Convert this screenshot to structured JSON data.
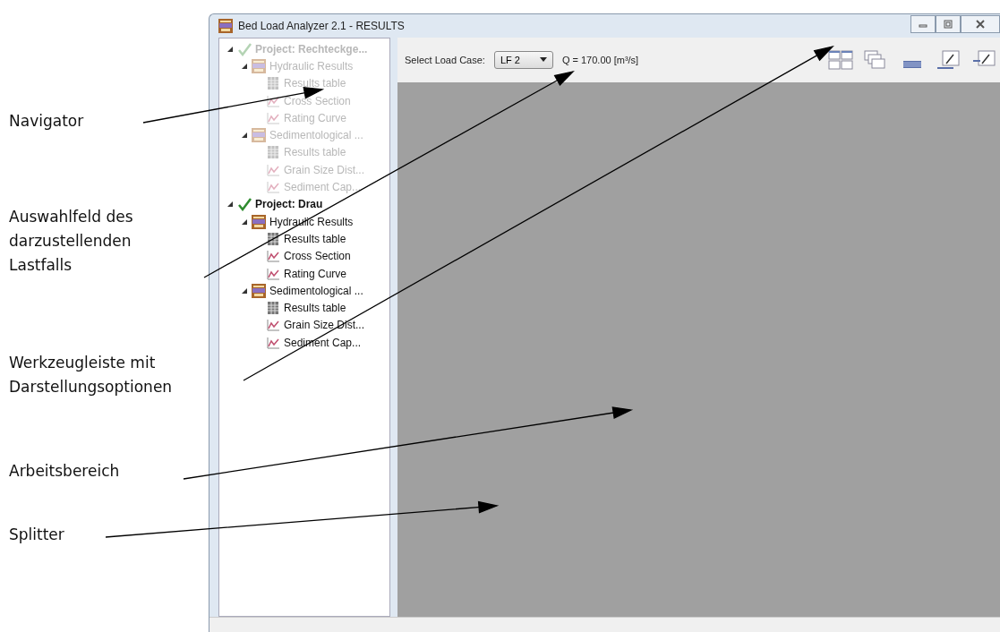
{
  "annotations": [
    {
      "label": "Navigator"
    },
    {
      "label": "Auswahlfeld des darzustellenden Lastfalls"
    },
    {
      "label": "Werkzeugleiste mit Darstellungsoptionen"
    },
    {
      "label": "Arbeitsbereich"
    },
    {
      "label": "Splitter"
    }
  ],
  "window": {
    "title": "Bed Load Analyzer 2.1 - RESULTS"
  },
  "tree": [
    {
      "kind": "project",
      "label": "Project: Rechteckge...",
      "disabled": true,
      "expanded": true,
      "children": [
        {
          "kind": "group",
          "label": "Hydraulic Results",
          "expanded": true,
          "children": [
            {
              "kind": "table",
              "label": "Results table"
            },
            {
              "kind": "chart",
              "label": "Cross Section"
            },
            {
              "kind": "chart",
              "label": "Rating Curve"
            }
          ]
        },
        {
          "kind": "group",
          "label": "Sedimentological ...",
          "expanded": true,
          "children": [
            {
              "kind": "table",
              "label": "Results table"
            },
            {
              "kind": "chart",
              "label": "Grain Size Dist..."
            },
            {
              "kind": "chart",
              "label": "Sediment Cap..."
            }
          ]
        }
      ]
    },
    {
      "kind": "project",
      "label": "Project: Drau",
      "disabled": false,
      "expanded": true,
      "children": [
        {
          "kind": "group",
          "label": "Hydraulic Results",
          "expanded": true,
          "children": [
            {
              "kind": "table",
              "label": "Results table"
            },
            {
              "kind": "chart",
              "label": "Cross Section"
            },
            {
              "kind": "chart",
              "label": "Rating Curve"
            }
          ]
        },
        {
          "kind": "group",
          "label": "Sedimentological ...",
          "expanded": true,
          "children": [
            {
              "kind": "table",
              "label": "Results table"
            },
            {
              "kind": "chart",
              "label": "Grain Size Dist..."
            },
            {
              "kind": "chart",
              "label": "Sediment Cap..."
            }
          ]
        }
      ]
    }
  ],
  "toolbar": {
    "load_case_label": "Select Load Case:",
    "load_case": "LF 2",
    "discharge": "Q = 170.00 [m³/s]"
  }
}
